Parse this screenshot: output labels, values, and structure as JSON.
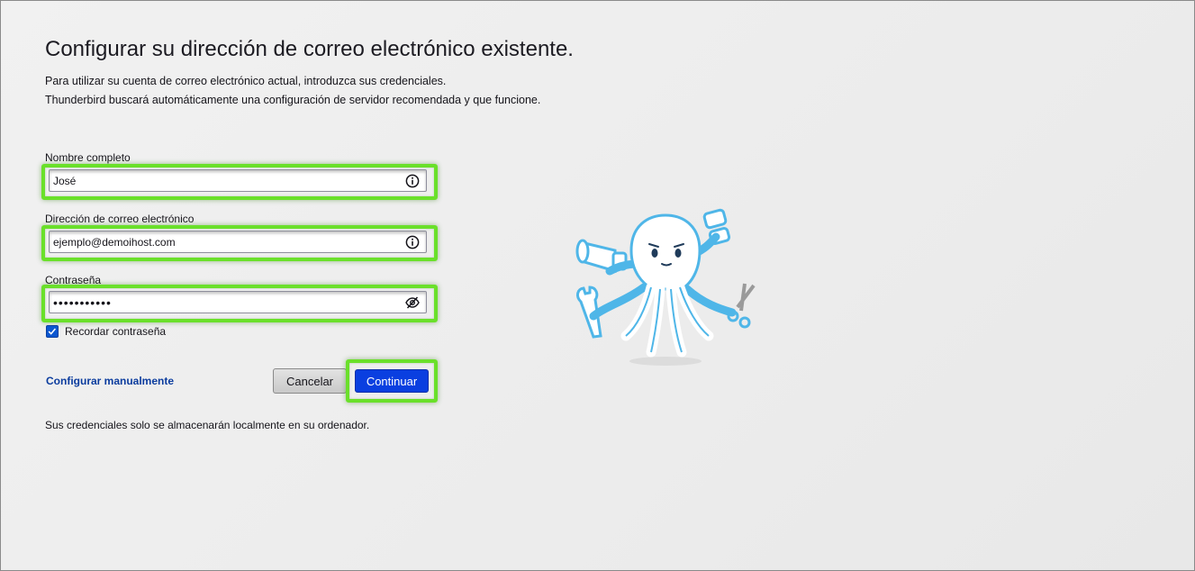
{
  "header": {
    "title": "Configurar su dirección de correo electrónico existente.",
    "description_line1": "Para utilizar su cuenta de correo electrónico actual, introduzca sus credenciales.",
    "description_line2": "Thunderbird buscará automáticamente una configuración de servidor recomendada y que funcione."
  },
  "form": {
    "name": {
      "label": "Nombre completo",
      "value": "José",
      "icon": "info-icon"
    },
    "email": {
      "label": "Dirección de correo electrónico",
      "value": "ejemplo@demoihost.com",
      "icon": "info-icon"
    },
    "password": {
      "label": "Contraseña",
      "value": "•••••••••••",
      "icon": "eye-slash-icon"
    },
    "remember": {
      "label": "Recordar contraseña",
      "checked": true
    }
  },
  "actions": {
    "manual_link": "Configurar manualmente",
    "cancel_label": "Cancelar",
    "continue_label": "Continuar"
  },
  "footer": {
    "note": "Sus credenciales solo se almacenarán localmente en su ordenador."
  },
  "colors": {
    "highlight": "#6ae02a",
    "primary_button": "#0a3fe0",
    "link": "#0b3c9e",
    "mascot": "#4fb6e8"
  }
}
